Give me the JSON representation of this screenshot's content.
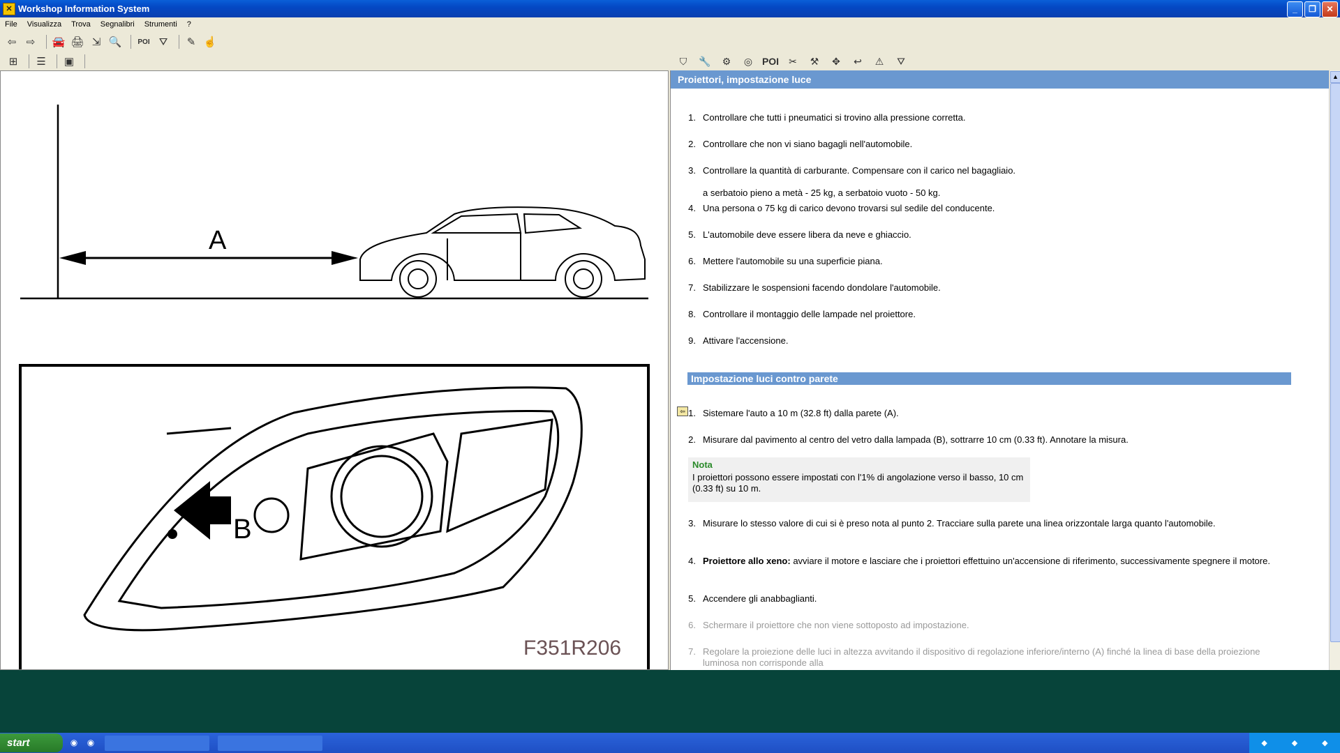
{
  "window": {
    "title": "Workshop Information System"
  },
  "menu": [
    "File",
    "Visualizza",
    "Trova",
    "Segnalibri",
    "Strumenti",
    "?"
  ],
  "toolbar": {
    "poi_label": "POI"
  },
  "toolbar_right": {
    "poi_label": "POI"
  },
  "illustration": {
    "label_a": "A",
    "label_b": "B",
    "figure_code": "F351R206"
  },
  "doc": {
    "header": "Proiettori, impostazione luce",
    "steps": [
      {
        "num": "1.",
        "text": "Controllare che tutti i pneumatici si trovino alla pressione corretta."
      },
      {
        "num": "2.",
        "text": "Controllare che non vi siano bagagli nell'automobile."
      },
      {
        "num": "3.",
        "text": "Controllare la quantità di carburante. Compensare con il carico nel bagagliaio."
      },
      {
        "num": "",
        "text": "a serbatoio pieno a metà - 25 kg, a serbatoio vuoto - 50 kg."
      },
      {
        "num": "4.",
        "text": "Una persona o 75 kg di carico devono trovarsi sul sedile del conducente."
      },
      {
        "num": "5.",
        "text": "L'automobile deve essere libera da neve e ghiaccio."
      },
      {
        "num": "6.",
        "text": "Mettere l'automobile su una superficie piana."
      },
      {
        "num": "7.",
        "text": "Stabilizzare le sospensioni facendo dondolare l'automobile."
      },
      {
        "num": "8.",
        "text": "Controllare il montaggio delle lampade nel proiettore."
      },
      {
        "num": "9.",
        "text": "Attivare l'accensione."
      }
    ],
    "section2": "Impostazione luci contro parete",
    "steps2": [
      {
        "num": "1.",
        "text": "Sistemare l'auto a 10 m (32.8 ft) dalla parete (A)."
      },
      {
        "num": "2.",
        "text": "Misurare dal pavimento al centro del vetro dalla lampada (B), sottrarre 10 cm (0.33 ft). Annotare la misura."
      }
    ],
    "nota": {
      "title": "Nota",
      "body": "I proiettori possono essere impostati con l'1% di angolazione verso il basso, 10 cm (0.33 ft) su 10 m."
    },
    "steps3": [
      {
        "num": "3.",
        "text": "Misurare lo stesso valore di cui si è preso nota al punto 2. Tracciare sulla parete una linea orizzontale larga quanto l'automobile."
      },
      {
        "num": "4.",
        "bold": "Proiettore allo xeno:",
        "text": " avviare il motore e lasciare che i proiettori effettuino un'accensione di riferimento, successivamente spegnere il motore."
      },
      {
        "num": "5.",
        "text": "Accendere gli anabbaglianti."
      },
      {
        "num": "6.",
        "text": "Schermare il proiettore che non viene sottoposto ad impostazione."
      },
      {
        "num": "7.",
        "text": "Regolare la proiezione delle luci in altezza avvitando il dispositivo di regolazione inferiore/interno (A) finché la linea di base della proiezione luminosa non corrisponde alla"
      }
    ]
  },
  "taskbar": {
    "start": "start"
  }
}
